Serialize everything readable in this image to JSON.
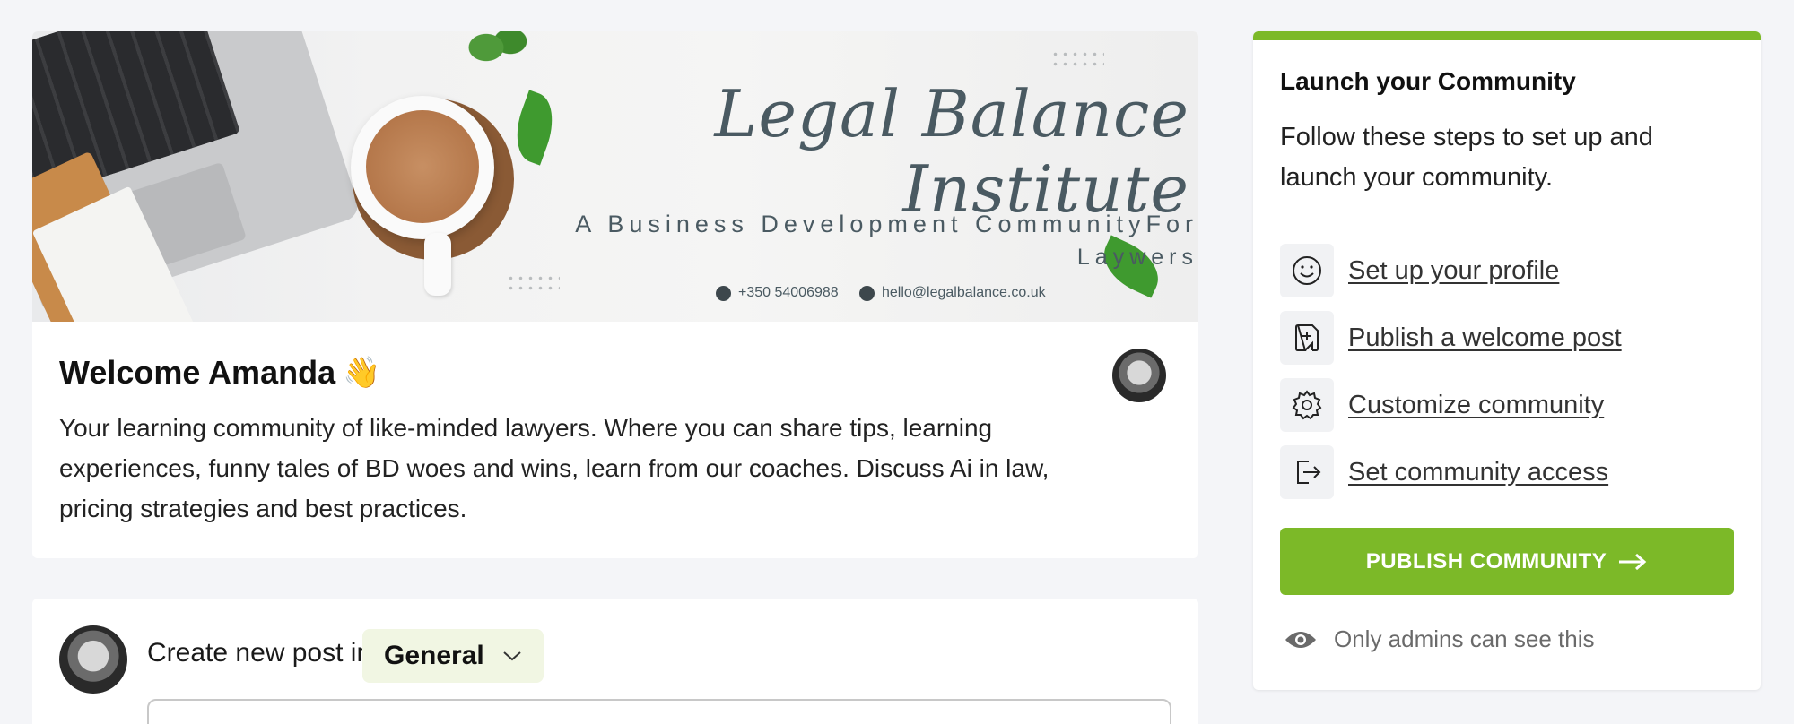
{
  "banner": {
    "title": "Legal Balance Institute",
    "subtitle_line1": "A Business Development CommunityFor",
    "subtitle_line2": "Laywers",
    "phone": "+350 54006988",
    "email": "hello@legalbalance.co.uk"
  },
  "welcome": {
    "title": "Welcome Amanda",
    "emoji": "👋",
    "description": "Your learning community of like-minded lawyers. Where you can share tips, learning experiences, funny tales of BD woes and wins, learn from our coaches. Discuss Ai in law, pricing strategies and best practices."
  },
  "post": {
    "label": "Create new post in",
    "channel": "General"
  },
  "launch": {
    "title": "Launch your Community",
    "description": "Follow these steps to set up and launch your community.",
    "steps": [
      {
        "label": "Set up your profile",
        "icon": "smiley-icon"
      },
      {
        "label": "Publish a welcome post",
        "icon": "new-document-icon"
      },
      {
        "label": "Customize community",
        "icon": "gear-icon"
      },
      {
        "label": "Set community access",
        "icon": "sign-out-icon"
      }
    ],
    "publish_label": "PUBLISH COMMUNITY",
    "admin_note": "Only admins can see this"
  },
  "colors": {
    "accent": "#7cb928",
    "page_background": "#f4f5f8",
    "channel_pill": "#f1f6e3"
  }
}
